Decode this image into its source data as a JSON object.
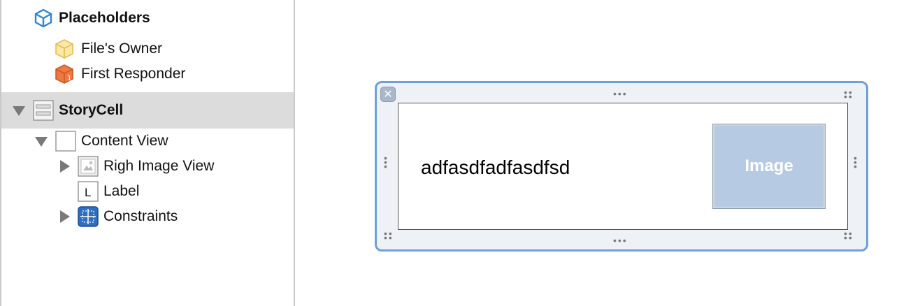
{
  "outline": {
    "placeholders_label": "Placeholders",
    "files_owner_label": "File's Owner",
    "first_responder_label": "First Responder",
    "story_cell_label": "StoryCell",
    "content_view_label": "Content View",
    "righ_image_view_label": "Righ Image View",
    "label_item_label": "Label",
    "label_icon_glyph": "L",
    "constraints_label": "Constraints"
  },
  "canvas": {
    "cell_label_text": "adfasdfadfasdfsd",
    "image_placeholder_text": "Image",
    "close_glyph": "✕"
  },
  "colors": {
    "selection_bg": "#dcdcdc",
    "frame_border": "#6fa0d8",
    "image_fill": "#b6cbe3",
    "constraints_icon": "#2f6fbf",
    "first_responder_icon": "#e8743a",
    "files_owner_icon": "#f5d37a"
  }
}
